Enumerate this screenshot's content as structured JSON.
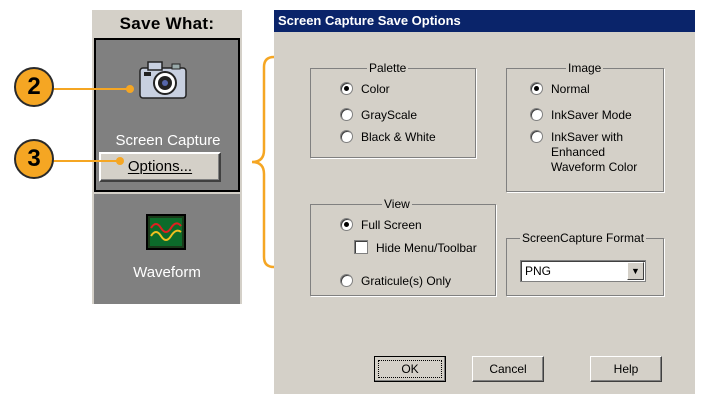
{
  "left_panel": {
    "header": "Save What:",
    "screen_capture_label": "Screen Capture",
    "options_button": "Options...",
    "waveform_label": "Waveform"
  },
  "callouts": {
    "step_a": "2",
    "step_b": "3"
  },
  "colors": {
    "callout": "#f5a623",
    "titlebar": "#0a246a",
    "dialog_bg": "#d4d0c8"
  },
  "dialog": {
    "title": "Screen Capture Save Options",
    "palette": {
      "label": "Palette",
      "options": [
        "Color",
        "GrayScale",
        "Black & White"
      ],
      "selected": "Color"
    },
    "image": {
      "label": "Image",
      "options": [
        "Normal",
        "InkSaver Mode",
        "InkSaver with",
        "Enhanced",
        "Waveform Color"
      ],
      "selected": "Normal"
    },
    "view": {
      "label": "View",
      "full_screen": "Full Screen",
      "hide_menu": "Hide Menu/Toolbar",
      "graticule": "Graticule(s) Only",
      "selected": "Full Screen"
    },
    "format": {
      "label": "ScreenCapture Format",
      "value": "PNG"
    },
    "buttons": {
      "ok": "OK",
      "cancel": "Cancel",
      "help": "Help"
    }
  }
}
